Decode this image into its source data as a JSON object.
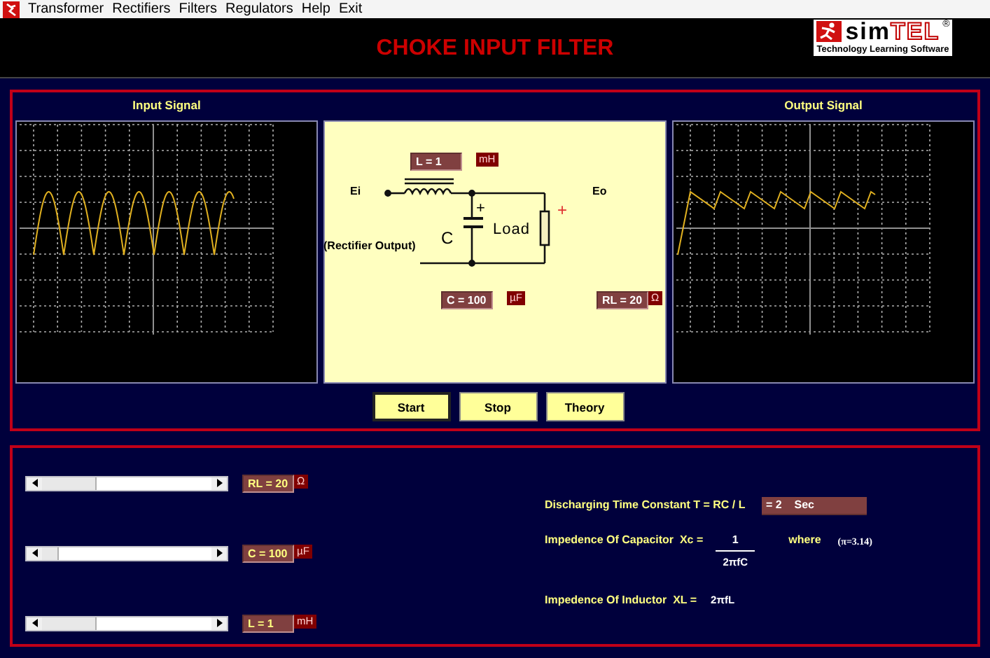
{
  "menu": [
    "Transformer",
    "Rectifiers",
    "Filters",
    "Regulators",
    "Help",
    "Exit"
  ],
  "title": "CHOKE INPUT FILTER",
  "logo": {
    "name_left": "sim",
    "name_right": "TEL",
    "registered": "®",
    "tagline": "Technology Learning Software"
  },
  "scopes": [
    {
      "title": "Input Signal",
      "kind": "rectified"
    },
    {
      "title": "Output Signal",
      "kind": "filtered"
    }
  ],
  "circuit": {
    "input_label": "Ei",
    "output_label": "Eo",
    "source_label": "(Rectifier Output)",
    "capacitor_symbol": "C",
    "capacitor_polarity": "+",
    "load_label": "Load",
    "output_polarity": "+",
    "inductor": {
      "value": "L = 1",
      "unit": "mH"
    },
    "capacitor": {
      "value": "C = 100",
      "unit": "µF"
    },
    "load": {
      "value": "RL = 20",
      "unit": "Ω"
    }
  },
  "buttons": [
    {
      "label": "Start",
      "focused": true
    },
    {
      "label": "Stop",
      "focused": false
    },
    {
      "label": "Theory",
      "focused": false
    }
  ],
  "sliders": [
    {
      "value": "RL = 20",
      "unit": "Ω",
      "level": 0.32
    },
    {
      "value": "C = 100",
      "unit": "µF",
      "level": 0.1
    },
    {
      "value": "L = 1",
      "unit": "mH",
      "level": 0.32
    }
  ],
  "formulas": {
    "time_constant": {
      "label": "Discharging Time Constant T = RC / L",
      "result": "= 2    Sec"
    },
    "capacitor_impedance": {
      "label": "Impedence Of Capacitor  Xc =",
      "numerator": "1",
      "denominator": "2πfC",
      "where": "where",
      "note": "(π=3.14)"
    },
    "inductor_impedance": {
      "label": "Impedence Of Inductor  XL =",
      "value": "2πfL"
    }
  }
}
